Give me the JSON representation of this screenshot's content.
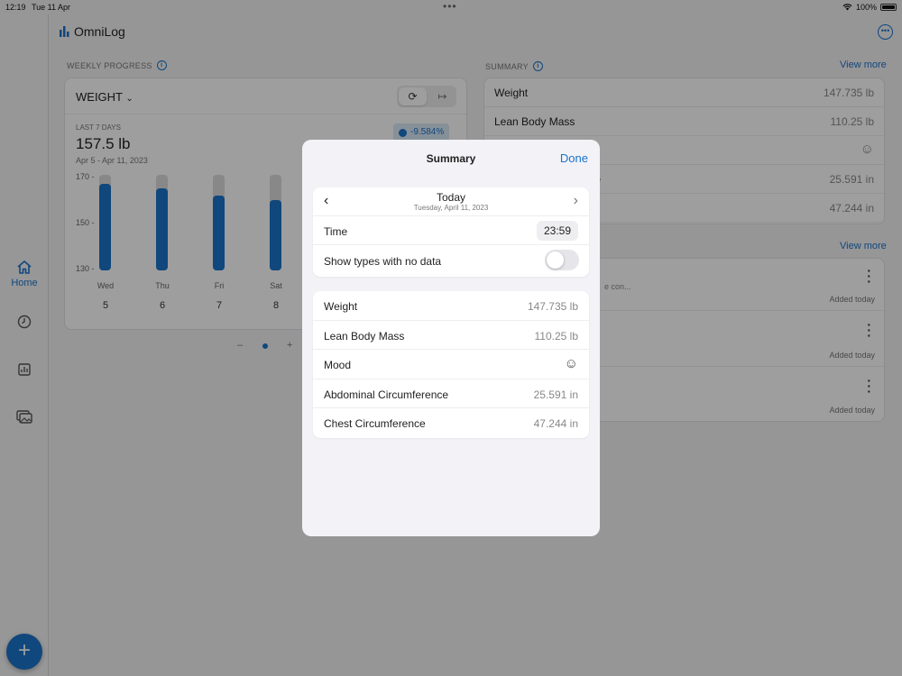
{
  "status": {
    "time": "12:19",
    "date": "Tue 11 Apr",
    "battery": "100%"
  },
  "app": {
    "title": "OmniLog"
  },
  "nav": {
    "home_label": "Home"
  },
  "weekly": {
    "section_label": "WEEKLY PROGRESS",
    "metric": "WEIGHT",
    "range_label": "LAST 7 DAYS",
    "value": "157.5 lb",
    "dates": "Apr 5 - Apr 11, 2023",
    "change": "-9.584%",
    "yticks": [
      "170 -",
      "150 -",
      "130 -"
    ],
    "days": [
      {
        "name": "Wed",
        "num": "5"
      },
      {
        "name": "Thu",
        "num": "6"
      },
      {
        "name": "Fri",
        "num": "7"
      },
      {
        "name": "Sat",
        "num": "8"
      }
    ],
    "pager_minus": "–",
    "pager_plus": "+"
  },
  "chart_data": {
    "type": "bar",
    "categories": [
      "Wed",
      "Thu",
      "Fri",
      "Sat"
    ],
    "values": [
      167,
      165,
      162,
      160
    ],
    "ylim": [
      130,
      170
    ],
    "yticks": [
      170,
      150,
      130
    ]
  },
  "summary_bg": {
    "section_label": "SUMMARY",
    "view_more": "View more",
    "rows": [
      {
        "label": "Weight",
        "value": "147.735 lb"
      },
      {
        "label": "Lean Body Mass",
        "value": "110.25 lb"
      },
      {
        "label": "",
        "value": "☺"
      },
      {
        "label": "ence",
        "value": "25.591 in"
      },
      {
        "label": "",
        "value": "47.244 in"
      }
    ]
  },
  "notes_bg": {
    "view_more": "View more",
    "items": [
      {
        "text": "e con...",
        "added": "Added today"
      },
      {
        "text": "",
        "added": "Added today"
      },
      {
        "text": "",
        "added": "Added today"
      }
    ]
  },
  "modal": {
    "title": "Summary",
    "done": "Done",
    "date_title": "Today",
    "date_sub": "Tuesday, April 11, 2023",
    "time_label": "Time",
    "time_value": "23:59",
    "toggle_label": "Show types with no data",
    "toggle_on": false,
    "rows": [
      {
        "label": "Weight",
        "value": "147.735 lb"
      },
      {
        "label": "Lean Body Mass",
        "value": "110.25 lb"
      },
      {
        "label": "Mood",
        "value": "☺"
      },
      {
        "label": "Abdominal Circumference",
        "value": "25.591 in"
      },
      {
        "label": "Chest Circumference",
        "value": "47.244 in"
      }
    ]
  },
  "colors": {
    "accent": "#1b73c9",
    "bar_bg": "#dcdcdc"
  }
}
